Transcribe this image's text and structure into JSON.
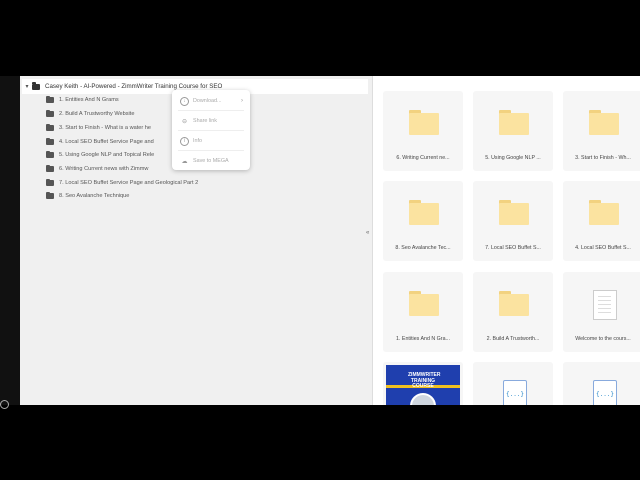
{
  "tree": {
    "root_label": "Casey Keith - AI-Powered - ZimmWriter Training Course for SEO",
    "items": [
      "1. Entities And N Grams",
      "2. Build A Trustworthy Website",
      "3. Start to Finish - What is a water he",
      "4. Local SEO Buffet Service Page and",
      "5. Using Google NLP and Topical Rele",
      "6. Writing Current news with Zimmw",
      "7. Local SEO Buffet Service Page and Geological Part 2",
      "8. Seo Avalanche Technique"
    ]
  },
  "context_menu": {
    "download": "Download...",
    "share_link": "Share link",
    "info": "Info",
    "save_to_mega": "Save to MEGA"
  },
  "collapse_glyph": "«",
  "grid": {
    "cards": [
      {
        "label": "6. Writing Current ne...",
        "kind": "folder"
      },
      {
        "label": "5. Using Google NLP ...",
        "kind": "folder"
      },
      {
        "label": "3. Start to Finish - Wh...",
        "kind": "folder"
      },
      {
        "label": "8. Seo Avalanche Tec...",
        "kind": "folder"
      },
      {
        "label": "7. Local SEO Buffet S...",
        "kind": "folder"
      },
      {
        "label": "4. Local SEO Buffet S...",
        "kind": "folder"
      },
      {
        "label": "1. Entities And N Gra...",
        "kind": "folder"
      },
      {
        "label": "2. Build A Trustworth...",
        "kind": "folder"
      },
      {
        "label": "Welcome to the cours...",
        "kind": "document"
      },
      {
        "label": "",
        "kind": "image",
        "thumb_text": "ZIMMWRITER TRAINING COURSE"
      },
      {
        "label": "",
        "kind": "json",
        "glyph": "{...}"
      },
      {
        "label": "",
        "kind": "json",
        "glyph": "{...}"
      }
    ]
  }
}
